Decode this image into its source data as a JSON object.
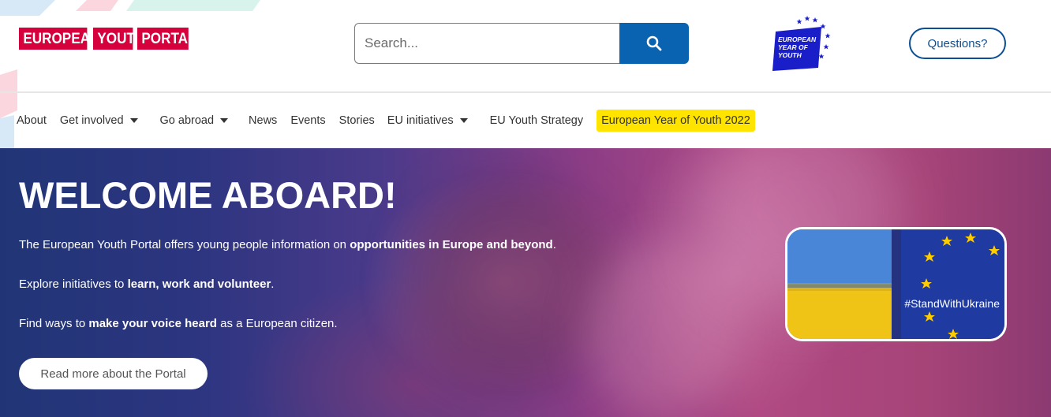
{
  "header": {
    "logo": [
      "EUROPEAN",
      "YOUTH",
      "PORTAL"
    ],
    "search": {
      "placeholder": "Search..."
    },
    "eyy_badge": [
      "EUROPEAN",
      "YEAR OF",
      "YOUTH"
    ],
    "questions_label": "Questions?"
  },
  "nav": {
    "items": [
      {
        "label": "About",
        "dropdown": false
      },
      {
        "label": "Get involved",
        "dropdown": true
      },
      {
        "label": "Go abroad",
        "dropdown": true
      },
      {
        "label": "News",
        "dropdown": false
      },
      {
        "label": "Events",
        "dropdown": false
      },
      {
        "label": "Stories",
        "dropdown": false
      },
      {
        "label": "EU initiatives",
        "dropdown": true
      },
      {
        "label": "EU Youth Strategy",
        "dropdown": false
      },
      {
        "label": "European Year of Youth 2022",
        "dropdown": false,
        "highlight": true
      }
    ]
  },
  "hero": {
    "title": "WELCOME ABOARD!",
    "p1_pre": "The European Youth Portal offers young people information on ",
    "p1_bold": "opportunities in Europe and beyond",
    "p1_post": ".",
    "p2_pre": "Explore initiatives to ",
    "p2_bold": "learn, work and volunteer",
    "p2_post": ".",
    "p3_pre": "Find ways to ",
    "p3_bold": "make your voice heard",
    "p3_post": " as a European citizen.",
    "read_more": "Read more about the Portal",
    "ukraine_tag": "#StandWithUkraine"
  },
  "colors": {
    "brand_red": "#d6003c",
    "search_button": "#0a63b0",
    "questions_border": "#0a4f96",
    "highlight_yellow": "#ffe400",
    "eyy_blue": "#1a1ec8"
  }
}
